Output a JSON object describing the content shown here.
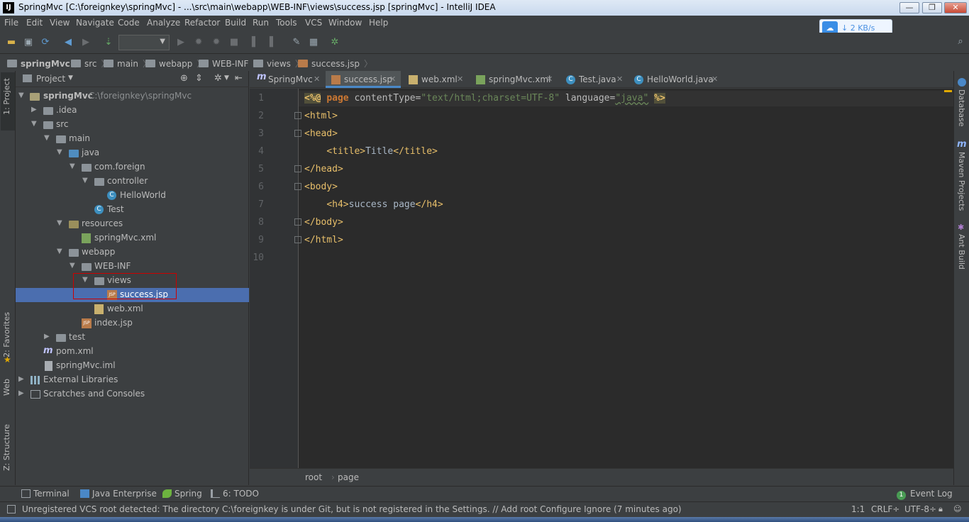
{
  "window": {
    "title": "SpringMvc [C:\\foreignkey\\springMvc] - ...\\src\\main\\webapp\\WEB-INF\\views\\success.jsp [springMvc] - IntelliJ IDEA",
    "logo": "IJ"
  },
  "menu": [
    "File",
    "Edit",
    "View",
    "Navigate",
    "Code",
    "Analyze",
    "Refactor",
    "Build",
    "Run",
    "Tools",
    "VCS",
    "Window",
    "Help"
  ],
  "netspeed": "↓ 2 KB/s",
  "breadcrumbs": [
    "springMvc",
    "src",
    "main",
    "webapp",
    "WEB-INF",
    "views",
    "success.jsp"
  ],
  "left_tabs": [
    "1: Project",
    "2: Favorites",
    "Web",
    "Z: Structure"
  ],
  "project": {
    "header": "Project",
    "tree": [
      {
        "label": "springMvc",
        "hint": "C:\\foreignkey\\springMvc",
        "icon": "module-folder-icon",
        "expanded": "open"
      },
      {
        "label": ".idea",
        "icon": "folder-icon",
        "expanded": "closed"
      },
      {
        "label": "src",
        "icon": "folder-icon",
        "expanded": "open"
      },
      {
        "label": "main",
        "icon": "folder-icon",
        "expanded": "open"
      },
      {
        "label": "java",
        "icon": "source-folder-icon",
        "expanded": "open"
      },
      {
        "label": "com.foreign",
        "icon": "package-icon",
        "expanded": "open"
      },
      {
        "label": "controller",
        "icon": "package-icon",
        "expanded": "open"
      },
      {
        "label": "HelloWorld",
        "icon": "class-icon",
        "expanded": "none"
      },
      {
        "label": "Test",
        "icon": "class-icon",
        "expanded": "none"
      },
      {
        "label": "resources",
        "icon": "resources-folder-icon",
        "expanded": "open"
      },
      {
        "label": "springMvc.xml",
        "icon": "spring-xml-icon",
        "expanded": "none"
      },
      {
        "label": "webapp",
        "icon": "web-folder-icon",
        "expanded": "open"
      },
      {
        "label": "WEB-INF",
        "icon": "folder-icon",
        "expanded": "open"
      },
      {
        "label": "views",
        "icon": "folder-icon",
        "expanded": "open"
      },
      {
        "label": "success.jsp",
        "icon": "jsp-file-icon",
        "expanded": "none",
        "selected": true
      },
      {
        "label": "web.xml",
        "icon": "xml-file-icon",
        "expanded": "none"
      },
      {
        "label": "index.jsp",
        "icon": "jsp-file-icon",
        "expanded": "none"
      },
      {
        "label": "test",
        "icon": "folder-icon",
        "expanded": "closed"
      },
      {
        "label": "pom.xml",
        "icon": "maven-icon",
        "expanded": "none"
      },
      {
        "label": "springMvc.iml",
        "icon": "iml-file-icon",
        "expanded": "none"
      },
      {
        "label": "External Libraries",
        "icon": "libraries-icon",
        "expanded": "closed"
      },
      {
        "label": "Scratches and Consoles",
        "icon": "scratches-icon",
        "expanded": "closed"
      }
    ]
  },
  "editor_tabs": [
    {
      "label": "SpringMvc",
      "icon": "maven-icon",
      "active": false
    },
    {
      "label": "success.jsp",
      "icon": "jsp-file-icon",
      "active": true
    },
    {
      "label": "web.xml",
      "icon": "xml-file-icon",
      "active": false
    },
    {
      "label": "springMvc.xml",
      "icon": "spring-xml-icon",
      "active": false
    },
    {
      "label": "Test.java",
      "icon": "class-icon",
      "active": false
    },
    {
      "label": "HelloWorld.java",
      "icon": "class-icon",
      "active": false
    }
  ],
  "code": {
    "line_numbers": [
      "1",
      "2",
      "3",
      "4",
      "5",
      "6",
      "7",
      "8",
      "9",
      "10"
    ],
    "line1": {
      "open": "<%@",
      "directive": "page",
      "attr1": "contentType=",
      "val1": "\"text/html;charset=UTF-8\"",
      "attr2": "language=",
      "val2": "\"java\"",
      "close": "%>"
    },
    "line2": "<html>",
    "line3": "<head>",
    "line4": {
      "open": "<title>",
      "text": "Title",
      "close": "</title>"
    },
    "line5": "</head>",
    "line6": "<body>",
    "line7": {
      "open": "<h4>",
      "text": "success page",
      "close": "</h4>"
    },
    "line8": "</body>",
    "line9": "</html>"
  },
  "editor_breadcrumb": [
    "root",
    "page"
  ],
  "right_tabs": [
    "Database",
    "Maven Projects",
    "Ant Build"
  ],
  "bottom_tabs": [
    "Terminal",
    "Java Enterprise",
    "Spring",
    "6: TODO"
  ],
  "event_log": {
    "badge": "1",
    "label": "Event Log"
  },
  "status": {
    "message": "Unregistered VCS root detected: The directory C:\\foreignkey is under Git, but is not registered in the Settings. // Add root  Configure  Ignore (7 minutes ago)",
    "position": "1:1",
    "line_sep": "CRLF÷",
    "encoding": "UTF-8÷"
  },
  "colors": {
    "selection": "#4b6eaf",
    "editor_bg": "#2b2b2b",
    "tag": "#e8bf6a",
    "string": "#6a8759",
    "keyword": "#cc7832",
    "highlight_box": "#cc0000"
  }
}
